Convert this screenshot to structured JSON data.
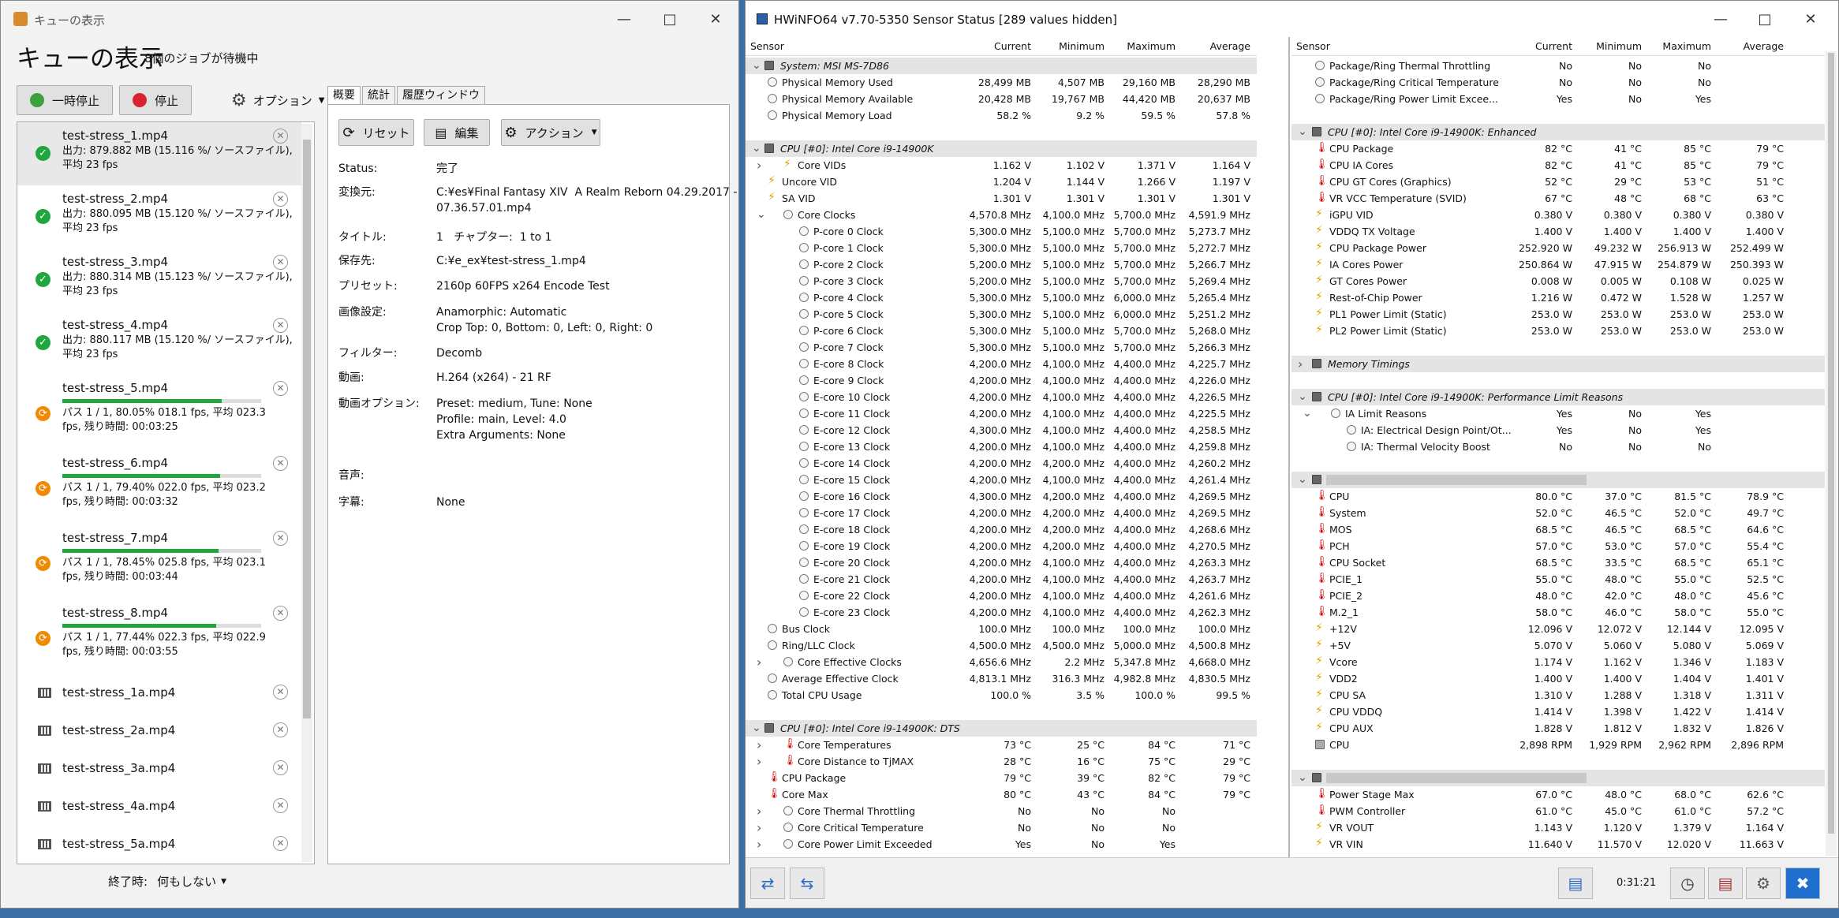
{
  "queue_window": {
    "title": "キューの表示",
    "heading": "キューの表示",
    "subtitle": "8個のジョブが待機中",
    "pause_label": "一時停止",
    "stop_label": "停止",
    "options_label": "オプション",
    "jobs": [
      {
        "name": "test-stress_1.mp4",
        "status": "done",
        "line1": "出力: 879.882 MB (15.116 %/ ソースファイル),",
        "line2": "平均 23 fps"
      },
      {
        "name": "test-stress_2.mp4",
        "status": "done",
        "line1": "出力: 880.095 MB (15.120 %/ ソースファイル),",
        "line2": "平均 23 fps"
      },
      {
        "name": "test-stress_3.mp4",
        "status": "done",
        "line1": "出力: 880.314 MB (15.123 %/ ソースファイル),",
        "line2": "平均 23 fps"
      },
      {
        "name": "test-stress_4.mp4",
        "status": "done",
        "line1": "出力: 880.117 MB (15.120 %/ ソースファイル),",
        "line2": "平均 23 fps"
      },
      {
        "name": "test-stress_5.mp4",
        "status": "running",
        "progress": 0.8005,
        "line1": "パス 1 / 1, 80.05% 018.1 fps, 平均 023.3",
        "line2": "fps, 残り時間: 00:03:25"
      },
      {
        "name": "test-stress_6.mp4",
        "status": "running",
        "progress": 0.794,
        "line1": "パス 1 / 1, 79.40% 022.0 fps, 平均 023.2",
        "line2": "fps, 残り時間: 00:03:32"
      },
      {
        "name": "test-stress_7.mp4",
        "status": "running",
        "progress": 0.7845,
        "line1": "パス 1 / 1, 78.45% 025.8 fps, 平均 023.1",
        "line2": "fps, 残り時間: 00:03:44"
      },
      {
        "name": "test-stress_8.mp4",
        "status": "running",
        "progress": 0.7744,
        "line1": "パス 1 / 1, 77.44% 022.3 fps, 平均 022.9",
        "line2": "fps, 残り時間: 00:03:55"
      },
      {
        "name": "test-stress_1a.mp4",
        "status": "waiting"
      },
      {
        "name": "test-stress_2a.mp4",
        "status": "waiting"
      },
      {
        "name": "test-stress_3a.mp4",
        "status": "waiting"
      },
      {
        "name": "test-stress_4a.mp4",
        "status": "waiting"
      },
      {
        "name": "test-stress_5a.mp4",
        "status": "waiting"
      }
    ],
    "tabs": [
      "概要",
      "統計",
      "履歴ウィンドウ"
    ],
    "reset_label": "リセット",
    "edit_label": "編集",
    "action_label": "アクション",
    "details": [
      {
        "label": "Status:",
        "value": "完了"
      },
      {
        "label": "変換元:",
        "value": "C:¥es¥Final Fantasy XIV  A Realm Reborn 04.29.2017 -\n07.36.57.01.mp4"
      },
      {
        "label": "タイトル:",
        "value": "1   チャプター:  1 to 1"
      },
      {
        "label": "保存先:",
        "value": "C:¥e_ex¥test-stress_1.mp4"
      },
      {
        "label": "プリセット:",
        "value": "2160p 60FPS x264 Encode Test"
      },
      {
        "label": "画像設定:",
        "value": "Anamorphic: Automatic\nCrop Top: 0, Bottom: 0, Left: 0, Right: 0"
      },
      {
        "label": "フィルター:",
        "value": "Decomb"
      },
      {
        "label": "動画:",
        "value": "H.264 (x264) - 21 RF"
      },
      {
        "label": "動画オプション:",
        "value": "Preset: medium, Tune: None\nProfile: main, Level: 4.0\nExtra Arguments: None"
      },
      {
        "label": "音声:",
        "value": ""
      },
      {
        "label": "字幕:",
        "value": "None"
      }
    ],
    "when_done_label": "終了時:",
    "when_done_value": "何もしない"
  },
  "hwinfo": {
    "title": "HWiNFO64 v7.70-5350 Sensor Status [289 values hidden]",
    "headers": [
      "Sensor",
      "Current",
      "Minimum",
      "Maximum",
      "Average"
    ],
    "timer": "0:31:21",
    "left": [
      {
        "t": "g",
        "l": "System: MSI MS-7D86",
        "ex": "v",
        "ic": "cp"
      },
      {
        "l": "Physical Memory Used",
        "v": [
          "28,499 MB",
          "4,507 MB",
          "29,160 MB",
          "28,290 MB"
        ]
      },
      {
        "l": "Physical Memory Available",
        "v": [
          "20,428 MB",
          "19,767 MB",
          "44,420 MB",
          "20,637 MB"
        ]
      },
      {
        "l": "Physical Memory Load",
        "v": [
          "58.2 %",
          "9.2 %",
          "59.5 %",
          "57.8 %"
        ]
      },
      {
        "t": "s"
      },
      {
        "t": "g",
        "l": "CPU [#0]: Intel Core i9-14900K",
        "ex": "v",
        "ic": "cp"
      },
      {
        "l": "Core VIDs",
        "ex": ">",
        "ic": "bo",
        "ind": 1,
        "v": [
          "1.162 V",
          "1.102 V",
          "1.371 V",
          "1.164 V"
        ]
      },
      {
        "l": "Uncore VID",
        "ic": "bo",
        "v": [
          "1.204 V",
          "1.144 V",
          "1.266 V",
          "1.197 V"
        ]
      },
      {
        "l": "SA VID",
        "ic": "bo",
        "v": [
          "1.301 V",
          "1.301 V",
          "1.301 V",
          "1.301 V"
        ]
      },
      {
        "l": "Core Clocks",
        "ex": "v",
        "ind": 1,
        "v": [
          "4,570.8 MHz",
          "4,100.0 MHz",
          "5,700.0 MHz",
          "4,591.9 MHz"
        ]
      },
      {
        "l": "P-core 0 Clock",
        "ind": 2,
        "v": [
          "5,300.0 MHz",
          "5,100.0 MHz",
          "5,700.0 MHz",
          "5,273.7 MHz"
        ]
      },
      {
        "l": "P-core 1 Clock",
        "ind": 2,
        "v": [
          "5,300.0 MHz",
          "5,100.0 MHz",
          "5,700.0 MHz",
          "5,272.7 MHz"
        ]
      },
      {
        "l": "P-core 2 Clock",
        "ind": 2,
        "v": [
          "5,200.0 MHz",
          "5,100.0 MHz",
          "5,700.0 MHz",
          "5,266.7 MHz"
        ]
      },
      {
        "l": "P-core 3 Clock",
        "ind": 2,
        "v": [
          "5,200.0 MHz",
          "5,100.0 MHz",
          "5,700.0 MHz",
          "5,269.4 MHz"
        ]
      },
      {
        "l": "P-core 4 Clock",
        "ind": 2,
        "v": [
          "5,300.0 MHz",
          "5,100.0 MHz",
          "6,000.0 MHz",
          "5,265.4 MHz"
        ]
      },
      {
        "l": "P-core 5 Clock",
        "ind": 2,
        "v": [
          "5,300.0 MHz",
          "5,100.0 MHz",
          "6,000.0 MHz",
          "5,251.2 MHz"
        ]
      },
      {
        "l": "P-core 6 Clock",
        "ind": 2,
        "v": [
          "5,300.0 MHz",
          "5,100.0 MHz",
          "5,700.0 MHz",
          "5,268.0 MHz"
        ]
      },
      {
        "l": "P-core 7 Clock",
        "ind": 2,
        "v": [
          "5,300.0 MHz",
          "5,100.0 MHz",
          "5,700.0 MHz",
          "5,266.3 MHz"
        ]
      },
      {
        "l": "E-core 8 Clock",
        "ind": 2,
        "v": [
          "4,200.0 MHz",
          "4,100.0 MHz",
          "4,400.0 MHz",
          "4,225.7 MHz"
        ]
      },
      {
        "l": "E-core 9 Clock",
        "ind": 2,
        "v": [
          "4,200.0 MHz",
          "4,100.0 MHz",
          "4,400.0 MHz",
          "4,226.0 MHz"
        ]
      },
      {
        "l": "E-core 10 Clock",
        "ind": 2,
        "v": [
          "4,200.0 MHz",
          "4,100.0 MHz",
          "4,400.0 MHz",
          "4,226.5 MHz"
        ]
      },
      {
        "l": "E-core 11 Clock",
        "ind": 2,
        "v": [
          "4,200.0 MHz",
          "4,100.0 MHz",
          "4,400.0 MHz",
          "4,225.5 MHz"
        ]
      },
      {
        "l": "E-core 12 Clock",
        "ind": 2,
        "v": [
          "4,300.0 MHz",
          "4,100.0 MHz",
          "4,400.0 MHz",
          "4,258.5 MHz"
        ]
      },
      {
        "l": "E-core 13 Clock",
        "ind": 2,
        "v": [
          "4,200.0 MHz",
          "4,100.0 MHz",
          "4,400.0 MHz",
          "4,259.8 MHz"
        ]
      },
      {
        "l": "E-core 14 Clock",
        "ind": 2,
        "v": [
          "4,200.0 MHz",
          "4,200.0 MHz",
          "4,400.0 MHz",
          "4,260.2 MHz"
        ]
      },
      {
        "l": "E-core 15 Clock",
        "ind": 2,
        "v": [
          "4,200.0 MHz",
          "4,100.0 MHz",
          "4,400.0 MHz",
          "4,261.4 MHz"
        ]
      },
      {
        "l": "E-core 16 Clock",
        "ind": 2,
        "v": [
          "4,300.0 MHz",
          "4,200.0 MHz",
          "4,400.0 MHz",
          "4,269.5 MHz"
        ]
      },
      {
        "l": "E-core 17 Clock",
        "ind": 2,
        "v": [
          "4,200.0 MHz",
          "4,200.0 MHz",
          "4,400.0 MHz",
          "4,269.5 MHz"
        ]
      },
      {
        "l": "E-core 18 Clock",
        "ind": 2,
        "v": [
          "4,200.0 MHz",
          "4,200.0 MHz",
          "4,400.0 MHz",
          "4,268.6 MHz"
        ]
      },
      {
        "l": "E-core 19 Clock",
        "ind": 2,
        "v": [
          "4,200.0 MHz",
          "4,200.0 MHz",
          "4,400.0 MHz",
          "4,270.5 MHz"
        ]
      },
      {
        "l": "E-core 20 Clock",
        "ind": 2,
        "v": [
          "4,200.0 MHz",
          "4,100.0 MHz",
          "4,400.0 MHz",
          "4,263.3 MHz"
        ]
      },
      {
        "l": "E-core 21 Clock",
        "ind": 2,
        "v": [
          "4,200.0 MHz",
          "4,100.0 MHz",
          "4,400.0 MHz",
          "4,263.7 MHz"
        ]
      },
      {
        "l": "E-core 22 Clock",
        "ind": 2,
        "v": [
          "4,200.0 MHz",
          "4,100.0 MHz",
          "4,400.0 MHz",
          "4,261.6 MHz"
        ]
      },
      {
        "l": "E-core 23 Clock",
        "ind": 2,
        "v": [
          "4,200.0 MHz",
          "4,100.0 MHz",
          "4,400.0 MHz",
          "4,262.3 MHz"
        ]
      },
      {
        "l": "Bus Clock",
        "v": [
          "100.0 MHz",
          "100.0 MHz",
          "100.0 MHz",
          "100.0 MHz"
        ]
      },
      {
        "l": "Ring/LLC Clock",
        "v": [
          "4,500.0 MHz",
          "4,500.0 MHz",
          "5,000.0 MHz",
          "4,500.8 MHz"
        ]
      },
      {
        "l": "Core Effective Clocks",
        "ex": ">",
        "ind": 1,
        "v": [
          "4,656.6 MHz",
          "2.2 MHz",
          "5,347.8 MHz",
          "4,668.0 MHz"
        ]
      },
      {
        "l": "Average Effective Clock",
        "v": [
          "4,813.1 MHz",
          "316.3 MHz",
          "4,982.8 MHz",
          "4,830.5 MHz"
        ]
      },
      {
        "l": "Total CPU Usage",
        "v": [
          "100.0 %",
          "3.5 %",
          "100.0 %",
          "99.5 %"
        ]
      },
      {
        "t": "s"
      },
      {
        "t": "g",
        "l": "CPU [#0]: Intel Core i9-14900K: DTS",
        "ex": "v",
        "ic": "cp"
      },
      {
        "l": "Core Temperatures",
        "ex": ">",
        "ic": "th",
        "ind": 1,
        "v": [
          "73 °C",
          "25 °C",
          "84 °C",
          "71 °C"
        ]
      },
      {
        "l": "Core Distance to TjMAX",
        "ex": ">",
        "ic": "th",
        "ind": 1,
        "v": [
          "28 °C",
          "16 °C",
          "75 °C",
          "29 °C"
        ]
      },
      {
        "l": "CPU Package",
        "ic": "th",
        "v": [
          "79 °C",
          "39 °C",
          "82 °C",
          "79 °C"
        ]
      },
      {
        "l": "Core Max",
        "ic": "th",
        "v": [
          "80 °C",
          "43 °C",
          "84 °C",
          "79 °C"
        ]
      },
      {
        "l": "Core Thermal Throttling",
        "ex": ">",
        "ind": 1,
        "v": [
          "No",
          "No",
          "No",
          ""
        ]
      },
      {
        "l": "Core Critical Temperature",
        "ex": ">",
        "ind": 1,
        "v": [
          "No",
          "No",
          "No",
          ""
        ]
      },
      {
        "l": "Core Power Limit Exceeded",
        "ex": ">",
        "ind": 1,
        "v": [
          "Yes",
          "No",
          "Yes",
          ""
        ]
      }
    ],
    "right": [
      {
        "l": "Package/Ring Thermal Throttling",
        "v": [
          "No",
          "No",
          "No",
          ""
        ]
      },
      {
        "l": "Package/Ring Critical Temperature",
        "v": [
          "No",
          "No",
          "No",
          ""
        ]
      },
      {
        "l": "Package/Ring Power Limit Excee...",
        "v": [
          "Yes",
          "No",
          "Yes",
          ""
        ]
      },
      {
        "t": "s"
      },
      {
        "t": "g",
        "l": "CPU [#0]: Intel Core i9-14900K: Enhanced",
        "ex": "v",
        "ic": "cp"
      },
      {
        "l": "CPU Package",
        "ic": "th",
        "v": [
          "82 °C",
          "41 °C",
          "85 °C",
          "79 °C"
        ]
      },
      {
        "l": "CPU IA Cores",
        "ic": "th",
        "v": [
          "82 °C",
          "41 °C",
          "85 °C",
          "79 °C"
        ]
      },
      {
        "l": "CPU GT Cores (Graphics)",
        "ic": "th",
        "v": [
          "52 °C",
          "29 °C",
          "53 °C",
          "51 °C"
        ]
      },
      {
        "l": "VR VCC Temperature (SVID)",
        "ic": "th",
        "v": [
          "67 °C",
          "48 °C",
          "68 °C",
          "63 °C"
        ]
      },
      {
        "l": "iGPU VID",
        "ic": "bo",
        "v": [
          "0.380 V",
          "0.380 V",
          "0.380 V",
          "0.380 V"
        ]
      },
      {
        "l": "VDDQ TX Voltage",
        "ic": "bo",
        "v": [
          "1.400 V",
          "1.400 V",
          "1.400 V",
          "1.400 V"
        ]
      },
      {
        "l": "CPU Package Power",
        "ic": "bo",
        "v": [
          "252.920 W",
          "49.232 W",
          "256.913 W",
          "252.499 W"
        ]
      },
      {
        "l": "IA Cores Power",
        "ic": "bo",
        "v": [
          "250.864 W",
          "47.915 W",
          "254.879 W",
          "250.393 W"
        ]
      },
      {
        "l": "GT Cores Power",
        "ic": "bo",
        "v": [
          "0.008 W",
          "0.005 W",
          "0.108 W",
          "0.025 W"
        ]
      },
      {
        "l": "Rest-of-Chip Power",
        "ic": "bo",
        "v": [
          "1.216 W",
          "0.472 W",
          "1.528 W",
          "1.257 W"
        ]
      },
      {
        "l": "PL1 Power Limit (Static)",
        "ic": "bo",
        "v": [
          "253.0 W",
          "253.0 W",
          "253.0 W",
          "253.0 W"
        ]
      },
      {
        "l": "PL2 Power Limit (Static)",
        "ic": "bo",
        "v": [
          "253.0 W",
          "253.0 W",
          "253.0 W",
          "253.0 W"
        ]
      },
      {
        "t": "s"
      },
      {
        "t": "g",
        "l": "Memory Timings",
        "ex": ">"
      },
      {
        "t": "s"
      },
      {
        "t": "g",
        "l": "CPU [#0]: Intel Core i9-14900K: Performance Limit Reasons",
        "ex": "v",
        "ic": "cp"
      },
      {
        "l": "IA Limit Reasons",
        "ex": "v",
        "ind": 1,
        "v": [
          "Yes",
          "No",
          "Yes",
          ""
        ]
      },
      {
        "l": "IA: Electrical Design Point/Ot...",
        "ind": 2,
        "v": [
          "Yes",
          "No",
          "Yes",
          ""
        ]
      },
      {
        "l": "IA: Thermal Velocity Boost",
        "ind": 2,
        "v": [
          "No",
          "No",
          "No",
          ""
        ]
      },
      {
        "t": "s"
      },
      {
        "t": "g",
        "l": "",
        "ex": "v",
        "ic": "cp",
        "blur": 1
      },
      {
        "l": "CPU",
        "ic": "th",
        "v": [
          "80.0 °C",
          "37.0 °C",
          "81.5 °C",
          "78.9 °C"
        ]
      },
      {
        "l": "System",
        "ic": "th",
        "v": [
          "52.0 °C",
          "46.5 °C",
          "52.0 °C",
          "49.7 °C"
        ]
      },
      {
        "l": "MOS",
        "ic": "th",
        "v": [
          "68.5 °C",
          "46.5 °C",
          "68.5 °C",
          "64.6 °C"
        ]
      },
      {
        "l": "PCH",
        "ic": "th",
        "v": [
          "57.0 °C",
          "53.0 °C",
          "57.0 °C",
          "55.4 °C"
        ]
      },
      {
        "l": "CPU Socket",
        "ic": "th",
        "v": [
          "68.5 °C",
          "33.5 °C",
          "68.5 °C",
          "65.1 °C"
        ]
      },
      {
        "l": "PCIE_1",
        "ic": "th",
        "v": [
          "55.0 °C",
          "48.0 °C",
          "55.0 °C",
          "52.5 °C"
        ]
      },
      {
        "l": "PCIE_2",
        "ic": "th",
        "v": [
          "48.0 °C",
          "42.0 °C",
          "48.0 °C",
          "45.6 °C"
        ]
      },
      {
        "l": "M.2_1",
        "ic": "th",
        "v": [
          "58.0 °C",
          "46.0 °C",
          "58.0 °C",
          "55.0 °C"
        ]
      },
      {
        "l": "+12V",
        "ic": "bo",
        "v": [
          "12.096 V",
          "12.072 V",
          "12.144 V",
          "12.095 V"
        ]
      },
      {
        "l": "+5V",
        "ic": "bo",
        "v": [
          "5.070 V",
          "5.060 V",
          "5.080 V",
          "5.069 V"
        ]
      },
      {
        "l": "Vcore",
        "ic": "bo",
        "v": [
          "1.174 V",
          "1.162 V",
          "1.346 V",
          "1.183 V"
        ]
      },
      {
        "l": "VDD2",
        "ic": "bo",
        "v": [
          "1.400 V",
          "1.400 V",
          "1.404 V",
          "1.401 V"
        ]
      },
      {
        "l": "CPU SA",
        "ic": "bo",
        "v": [
          "1.310 V",
          "1.288 V",
          "1.318 V",
          "1.311 V"
        ]
      },
      {
        "l": "CPU VDDQ",
        "ic": "bo",
        "v": [
          "1.414 V",
          "1.398 V",
          "1.422 V",
          "1.414 V"
        ]
      },
      {
        "l": "CPU AUX",
        "ic": "bo",
        "v": [
          "1.828 V",
          "1.812 V",
          "1.832 V",
          "1.826 V"
        ]
      },
      {
        "l": "CPU",
        "ic": "fn",
        "v": [
          "2,898 RPM",
          "1,929 RPM",
          "2,962 RPM",
          "2,896 RPM"
        ]
      },
      {
        "t": "s"
      },
      {
        "t": "g",
        "l": "",
        "ex": "v",
        "ic": "cp",
        "blur": 1
      },
      {
        "l": "Power Stage Max",
        "ic": "th",
        "v": [
          "67.0 °C",
          "48.0 °C",
          "68.0 °C",
          "62.6 °C"
        ]
      },
      {
        "l": "PWM Controller",
        "ic": "th",
        "v": [
          "61.0 °C",
          "45.0 °C",
          "61.0 °C",
          "57.2 °C"
        ]
      },
      {
        "l": "VR VOUT",
        "ic": "bo",
        "v": [
          "1.143 V",
          "1.120 V",
          "1.379 V",
          "1.164 V"
        ]
      },
      {
        "l": "VR VIN",
        "ic": "bo",
        "v": [
          "11.640 V",
          "11.570 V",
          "12.020 V",
          "11.663 V"
        ]
      }
    ]
  }
}
